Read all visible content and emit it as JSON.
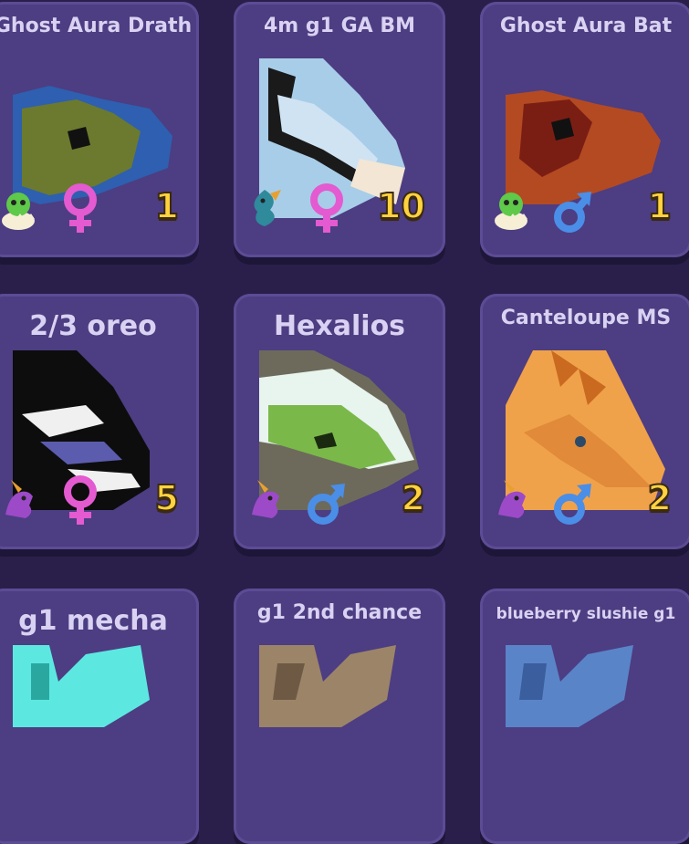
{
  "cards": [
    {
      "name": "Ghost Aura Drath",
      "count": "1",
      "sex": "female",
      "age": "baby",
      "colors": {
        "main": "#6b7a2e",
        "accent": "#2f5fb0"
      }
    },
    {
      "name": "4m g1 GA BM",
      "count": "10",
      "sex": "female",
      "age": "adult-blue",
      "colors": {
        "main": "#a8cde8",
        "accent": "#1a1a1a"
      }
    },
    {
      "name": "Ghost Aura Bat",
      "count": "1",
      "sex": "male",
      "age": "baby",
      "colors": {
        "main": "#b44a22",
        "accent": "#7a1e14"
      }
    },
    {
      "name": "2/3 oreo",
      "count": "5",
      "sex": "female",
      "age": "adult-purple",
      "colors": {
        "main": "#0d0d0d",
        "accent": "#5c5cae"
      }
    },
    {
      "name": "Hexalios",
      "count": "2",
      "sex": "male",
      "age": "adult-purple",
      "colors": {
        "main": "#7ab84a",
        "accent": "#e8f4ee"
      }
    },
    {
      "name": "Canteloupe MS",
      "count": "2",
      "sex": "male",
      "age": "adult-purple",
      "colors": {
        "main": "#f0a24a",
        "accent": "#c96a20"
      }
    },
    {
      "name": "g1 mecha",
      "count": "",
      "sex": "",
      "age": "",
      "colors": {
        "main": "#5ce8e0",
        "accent": "#2aa8a0"
      }
    },
    {
      "name": "g1 2nd chance",
      "count": "",
      "sex": "",
      "age": "",
      "colors": {
        "main": "#9c8468",
        "accent": "#6e5a44"
      }
    },
    {
      "name": "blueberry slushie g1",
      "count": "",
      "sex": "",
      "age": "",
      "colors": {
        "main": "#5a84c8",
        "accent": "#3a5e9e"
      }
    }
  ],
  "icons": {
    "female": "female-symbol-icon",
    "male": "male-symbol-icon",
    "baby": "hatchling-egg-icon",
    "adult-blue": "sea-dragon-icon",
    "adult-purple": "purple-dragon-icon"
  }
}
